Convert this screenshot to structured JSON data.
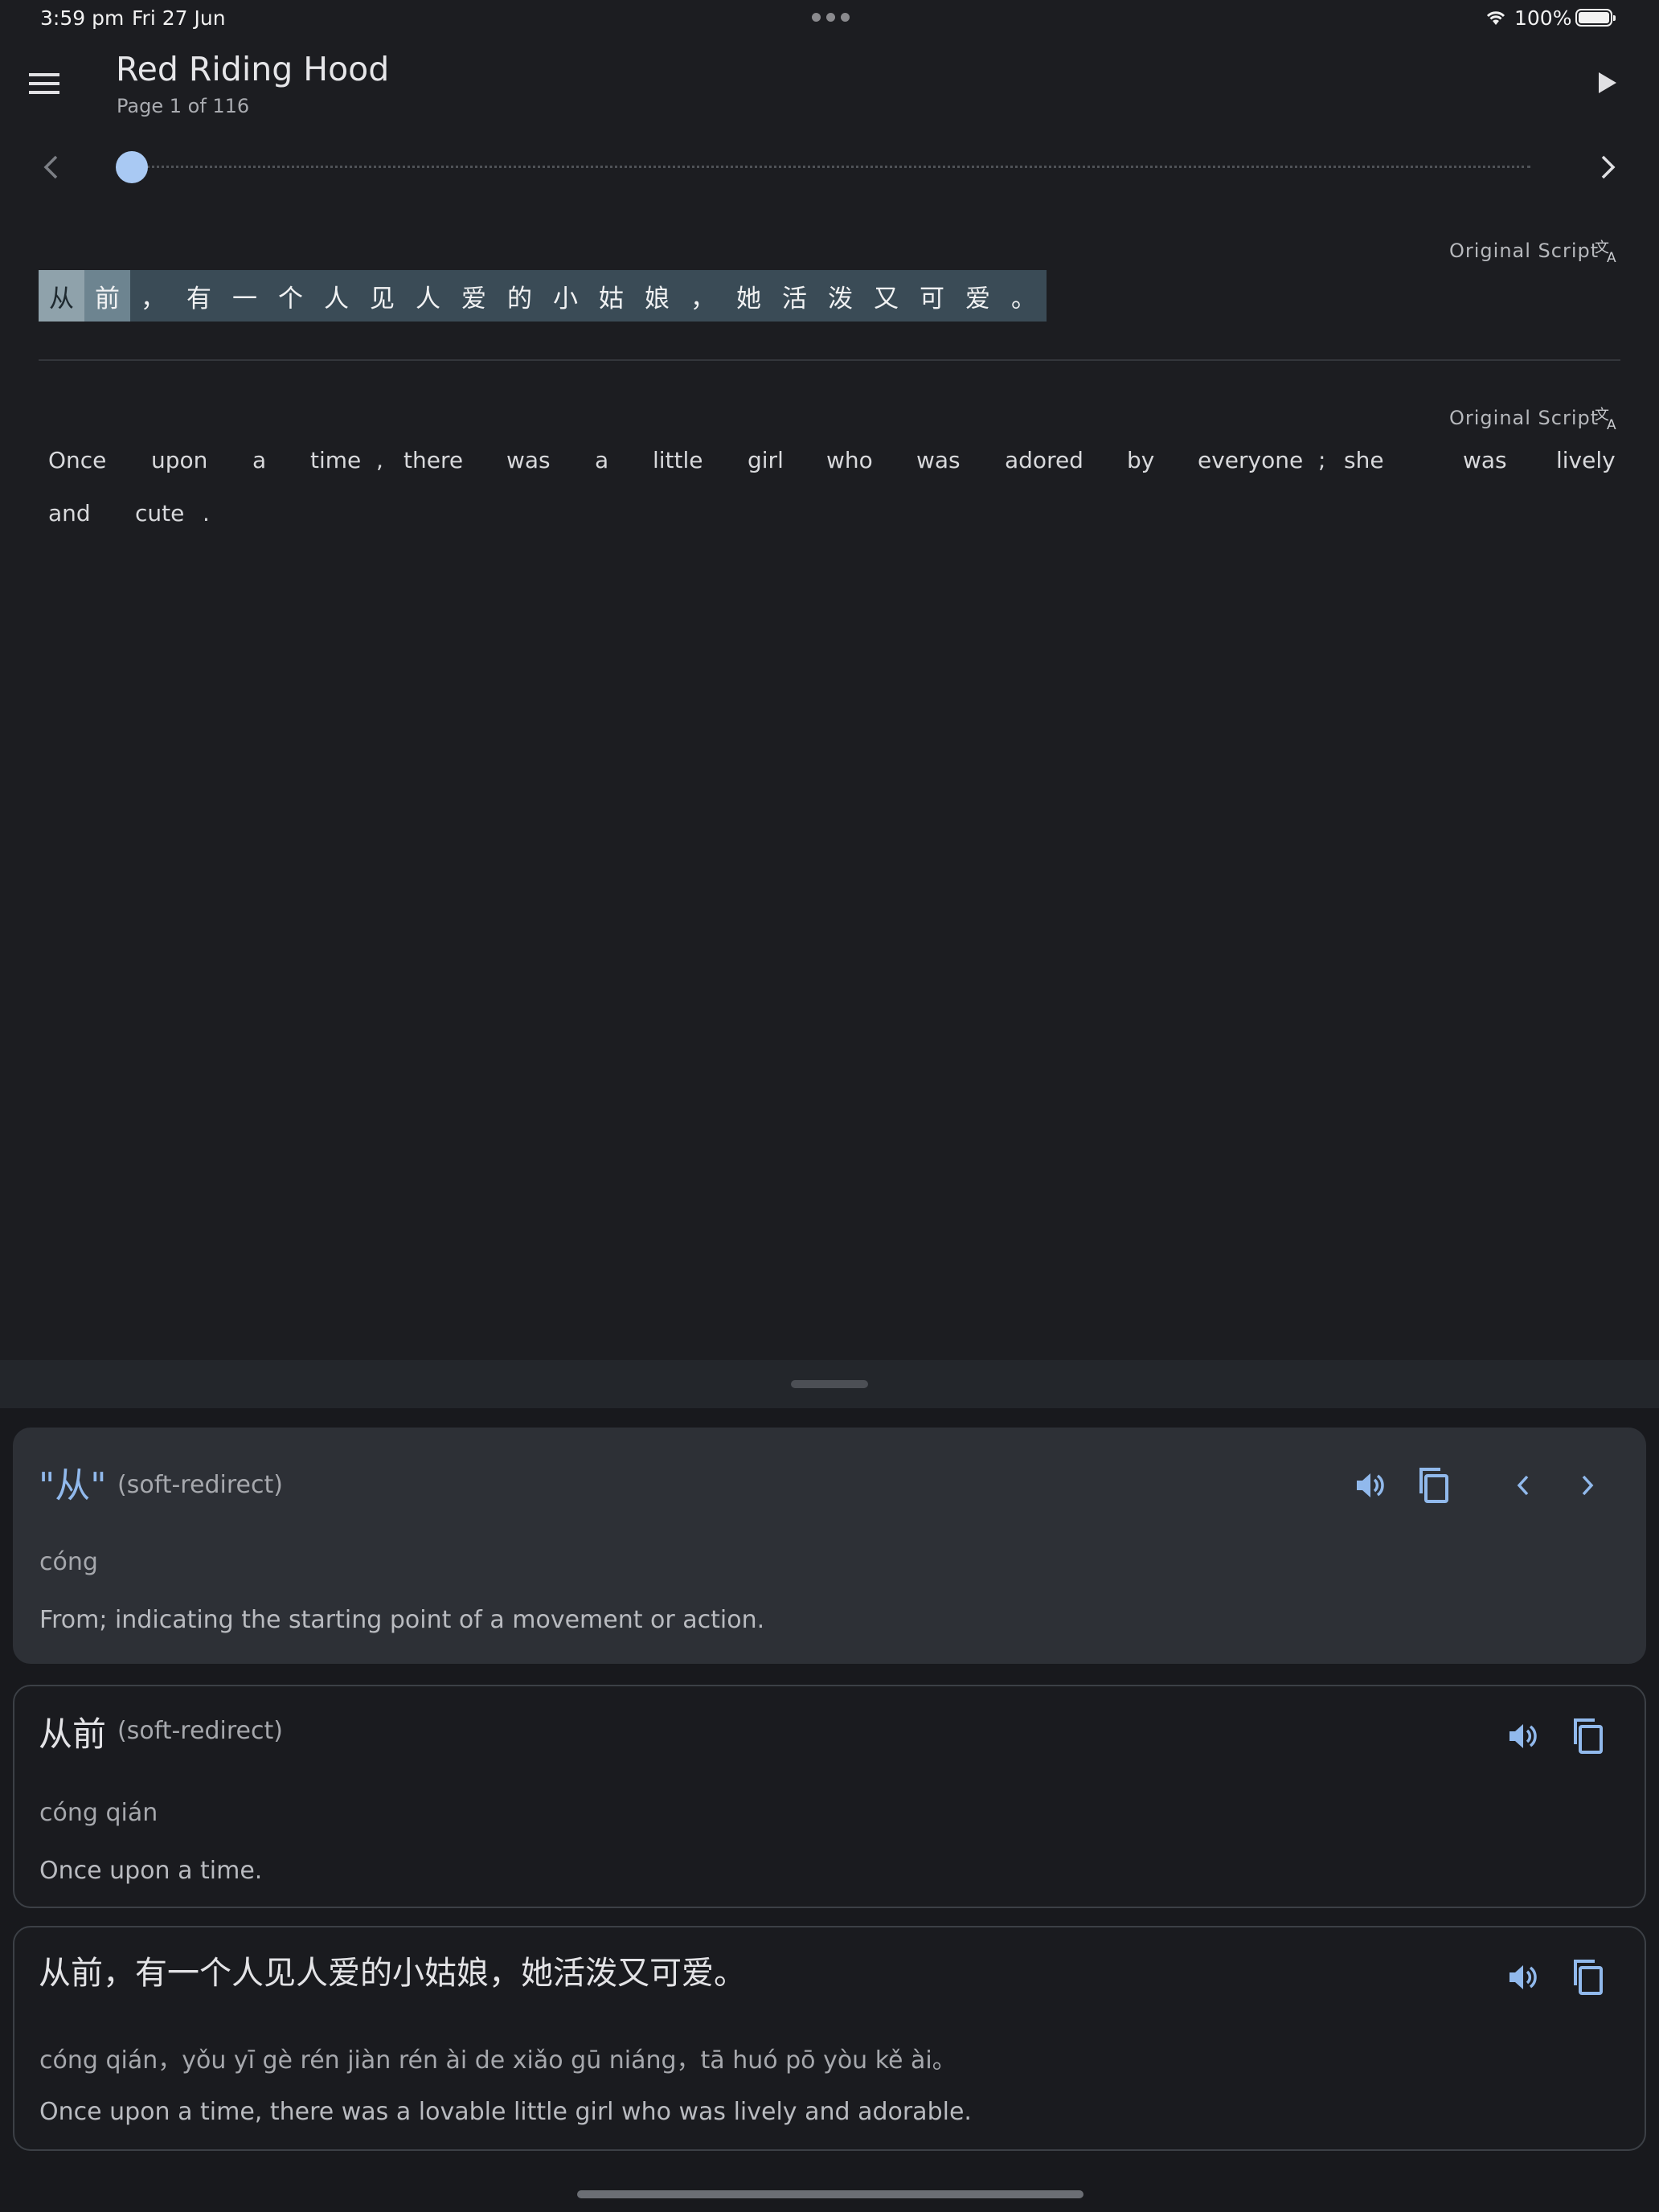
{
  "status_bar": {
    "time": "3:59 pm",
    "date": "Fri 27 Jun",
    "battery": "100%",
    "battery_level": 1.0
  },
  "app_bar": {
    "title": "Red Riding Hood",
    "subtitle": "Page 1 of 116"
  },
  "slider": {
    "current_page": 1,
    "total_pages": 116
  },
  "original_text": {
    "label": "Original Script",
    "characters": [
      "从",
      "前",
      "，",
      "有",
      "一",
      "个",
      "人",
      "见",
      "人",
      "爱",
      "的",
      "小",
      "姑",
      "娘",
      "，",
      "她",
      "活",
      "泼",
      "又",
      "可",
      "爱",
      "。"
    ]
  },
  "translation": {
    "label": "Original Script",
    "line1": [
      "Once",
      "upon",
      "a",
      "time",
      ",",
      "there",
      "was",
      "a",
      "little",
      "girl",
      "who",
      "was",
      "adored",
      "by",
      "everyone",
      ";",
      "she",
      "was",
      "lively"
    ],
    "line2": [
      "and",
      "cute",
      "."
    ]
  },
  "entries": [
    {
      "headword": "\"从\"",
      "tag": "(soft-redirect)",
      "pinyin": "cóng",
      "definition": "From; indicating the starting point of a movement or action."
    },
    {
      "headword": "从前",
      "tag": "(soft-redirect)",
      "pinyin": "cóng qián",
      "definition": "Once upon a time."
    },
    {
      "headword": "从前，有一个人见人爱的小姑娘，她活泼又可爱。",
      "pinyin": "cóng qián，yǒu yī gè rén jiàn rén ài de xiǎo gū niáng，tā huó pō yòu kě ài。",
      "definition": "Once upon a time, there was a lovable little girl who was lively and adorable."
    }
  ],
  "colors": {
    "accent": "#91b9ec",
    "highlight_row": "#3a4b56",
    "background": "#1c1d21"
  },
  "icons": [
    "menu-icon",
    "play-icon",
    "chevron-left-icon",
    "chevron-right-icon",
    "translate-icon",
    "speaker-icon",
    "copy-icon",
    "wifi-icon",
    "battery-icon"
  ]
}
